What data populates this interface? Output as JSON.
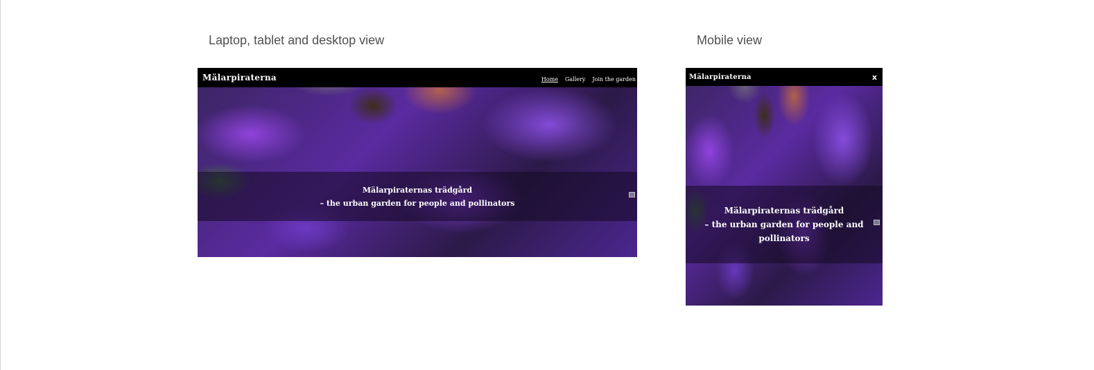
{
  "labels": {
    "desktop": "Laptop, tablet and desktop view",
    "mobile": "Mobile view"
  },
  "site": {
    "brand": "Mälarpiraterna",
    "nav": [
      {
        "label": "Home",
        "active": true
      },
      {
        "label": "Gallery",
        "active": false
      },
      {
        "label": "Join the garden",
        "active": false
      }
    ],
    "caption": {
      "line1": "Mälarpiraternas trädgård",
      "line2": "– the urban garden for people and pollinators",
      "line2_mobile_a": "– the urban garden for people and",
      "line2_mobile_b": "pollinators"
    },
    "close_symbol": "x"
  },
  "icons": {
    "close": "close-icon",
    "corner": "image-icon"
  }
}
